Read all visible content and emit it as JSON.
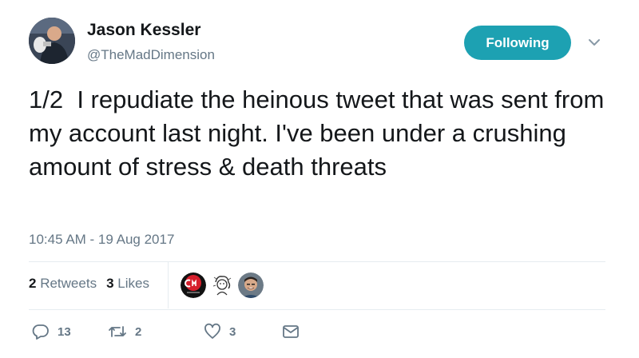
{
  "user": {
    "name": "Jason Kessler",
    "handle": "@TheMadDimension"
  },
  "follow_button": {
    "label": "Following",
    "color": "#1da1b2"
  },
  "tweet": {
    "text": "1/2  I repudiate the heinous tweet that was sent from my account last night. I've been under a crushing amount of stress & death threats",
    "timestamp": "10:45 AM - 19 Aug 2017"
  },
  "stats": {
    "retweets_count": "2",
    "retweets_label": "Retweets",
    "likes_count": "3",
    "likes_label": "Likes"
  },
  "likers": [
    {
      "icon": "cm-logo-avatar"
    },
    {
      "icon": "sketch-portrait-avatar"
    },
    {
      "icon": "man-photo-avatar"
    }
  ],
  "actions": {
    "reply_count": "13",
    "retweet_count": "2",
    "like_count": "3"
  },
  "colors": {
    "text": "#14171a",
    "muted": "#657786",
    "divider": "#e6ecf0"
  }
}
